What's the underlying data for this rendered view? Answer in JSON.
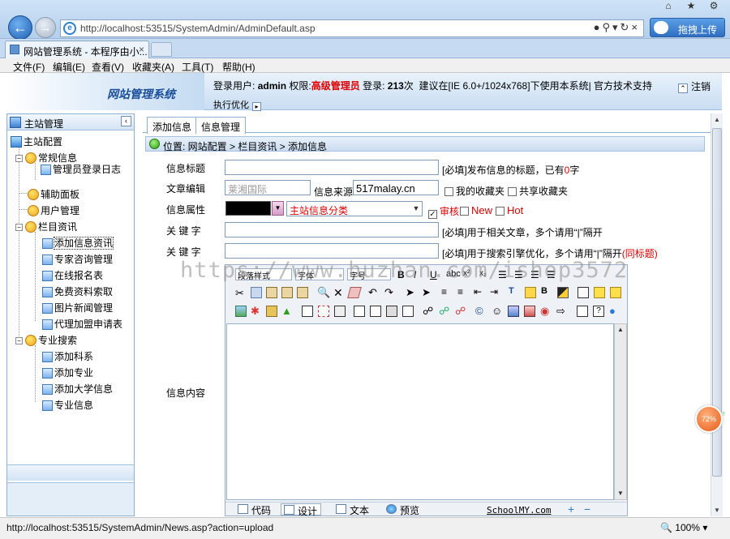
{
  "browser": {
    "url": "http://localhost:53515/SystemAdmin/AdminDefault.asp",
    "tab_title": "网站管理系统 - 本程序由小...",
    "upload_button": "拖拽上传",
    "menu": [
      "文件(F)",
      "编辑(E)",
      "查看(V)",
      "收藏夹(A)",
      "工具(T)",
      "帮助(H)"
    ],
    "status_url": "http://localhost:53515/SystemAdmin/News.asp?action=upload",
    "zoom": "100%",
    "widget_percent": "72%"
  },
  "header": {
    "app_title": "网站管理系统",
    "login_user_label": "登录用户:",
    "login_user": "admin",
    "rights_label": "权限:",
    "rights": "高级管理员",
    "login_count_label": "登录:",
    "login_count": "213",
    "login_count_unit": "次",
    "advice": "建议在[IE 6.0+/1024x768]下使用本系统| 官方技术支持",
    "logout": "注销",
    "optimize": "执行优化"
  },
  "sidebar": {
    "title": "主站管理",
    "root": "主站配置",
    "groups": [
      {
        "label": "常规信息",
        "items": [
          "管理员登录日志"
        ]
      },
      {
        "label": "辅助面板",
        "items": []
      },
      {
        "label": "用户管理",
        "items": []
      },
      {
        "label": "栏目资讯",
        "items": [
          "添加信息资讯",
          "专家咨询管理",
          "在线报名表",
          "免费资料索取",
          "图片新闻管理",
          "代理加盟申请表"
        ]
      },
      {
        "label": "专业搜索",
        "items": [
          "添加科系",
          "添加专业",
          "添加大学信息",
          "专业信息"
        ]
      }
    ]
  },
  "main": {
    "tabs": [
      "添加信息",
      "信息管理"
    ],
    "location": "位置: 网站配置 > 栏目资讯 > 添加信息",
    "form": {
      "title_label": "信息标题",
      "title_value": "",
      "title_hint_prefix": "[必填]发布信息的标题，已有",
      "title_count": "0",
      "title_hint_suffix": "字",
      "editor_label": "文章编辑",
      "editor_value": "莱湘国际",
      "source_label": "信息来源",
      "source_value": "517malay.cn",
      "fav_mine": "我的收藏夹",
      "fav_shared": "共享收藏夹",
      "attr_label": "信息属性",
      "category_placeholder": "主站信息分类",
      "audit": "审核",
      "new": "New",
      "hot": "Hot",
      "keywords_label": "关 键 字",
      "keywords_hint": "[必填]用于相关文章，多个请用“|”隔开",
      "keywords2_label": "关 键 字",
      "keywords2_hint": "[必填]用于搜索引擎优化，多个请用“|”隔开",
      "keywords2_same": "(同标题)",
      "content_label": "信息内容"
    },
    "editor": {
      "style_dropdown": "段落样式",
      "font_dropdown": "字体",
      "size_dropdown": "字号",
      "modes": [
        "代码",
        "设计",
        "文本",
        "预览"
      ],
      "brand": "SchoolMY.com"
    }
  },
  "watermark": "https://www.huzhan.com/ishop3572",
  "colors": {
    "accent": "#1b4f9c",
    "red": "#e00000",
    "border": "#8fb0d6"
  }
}
